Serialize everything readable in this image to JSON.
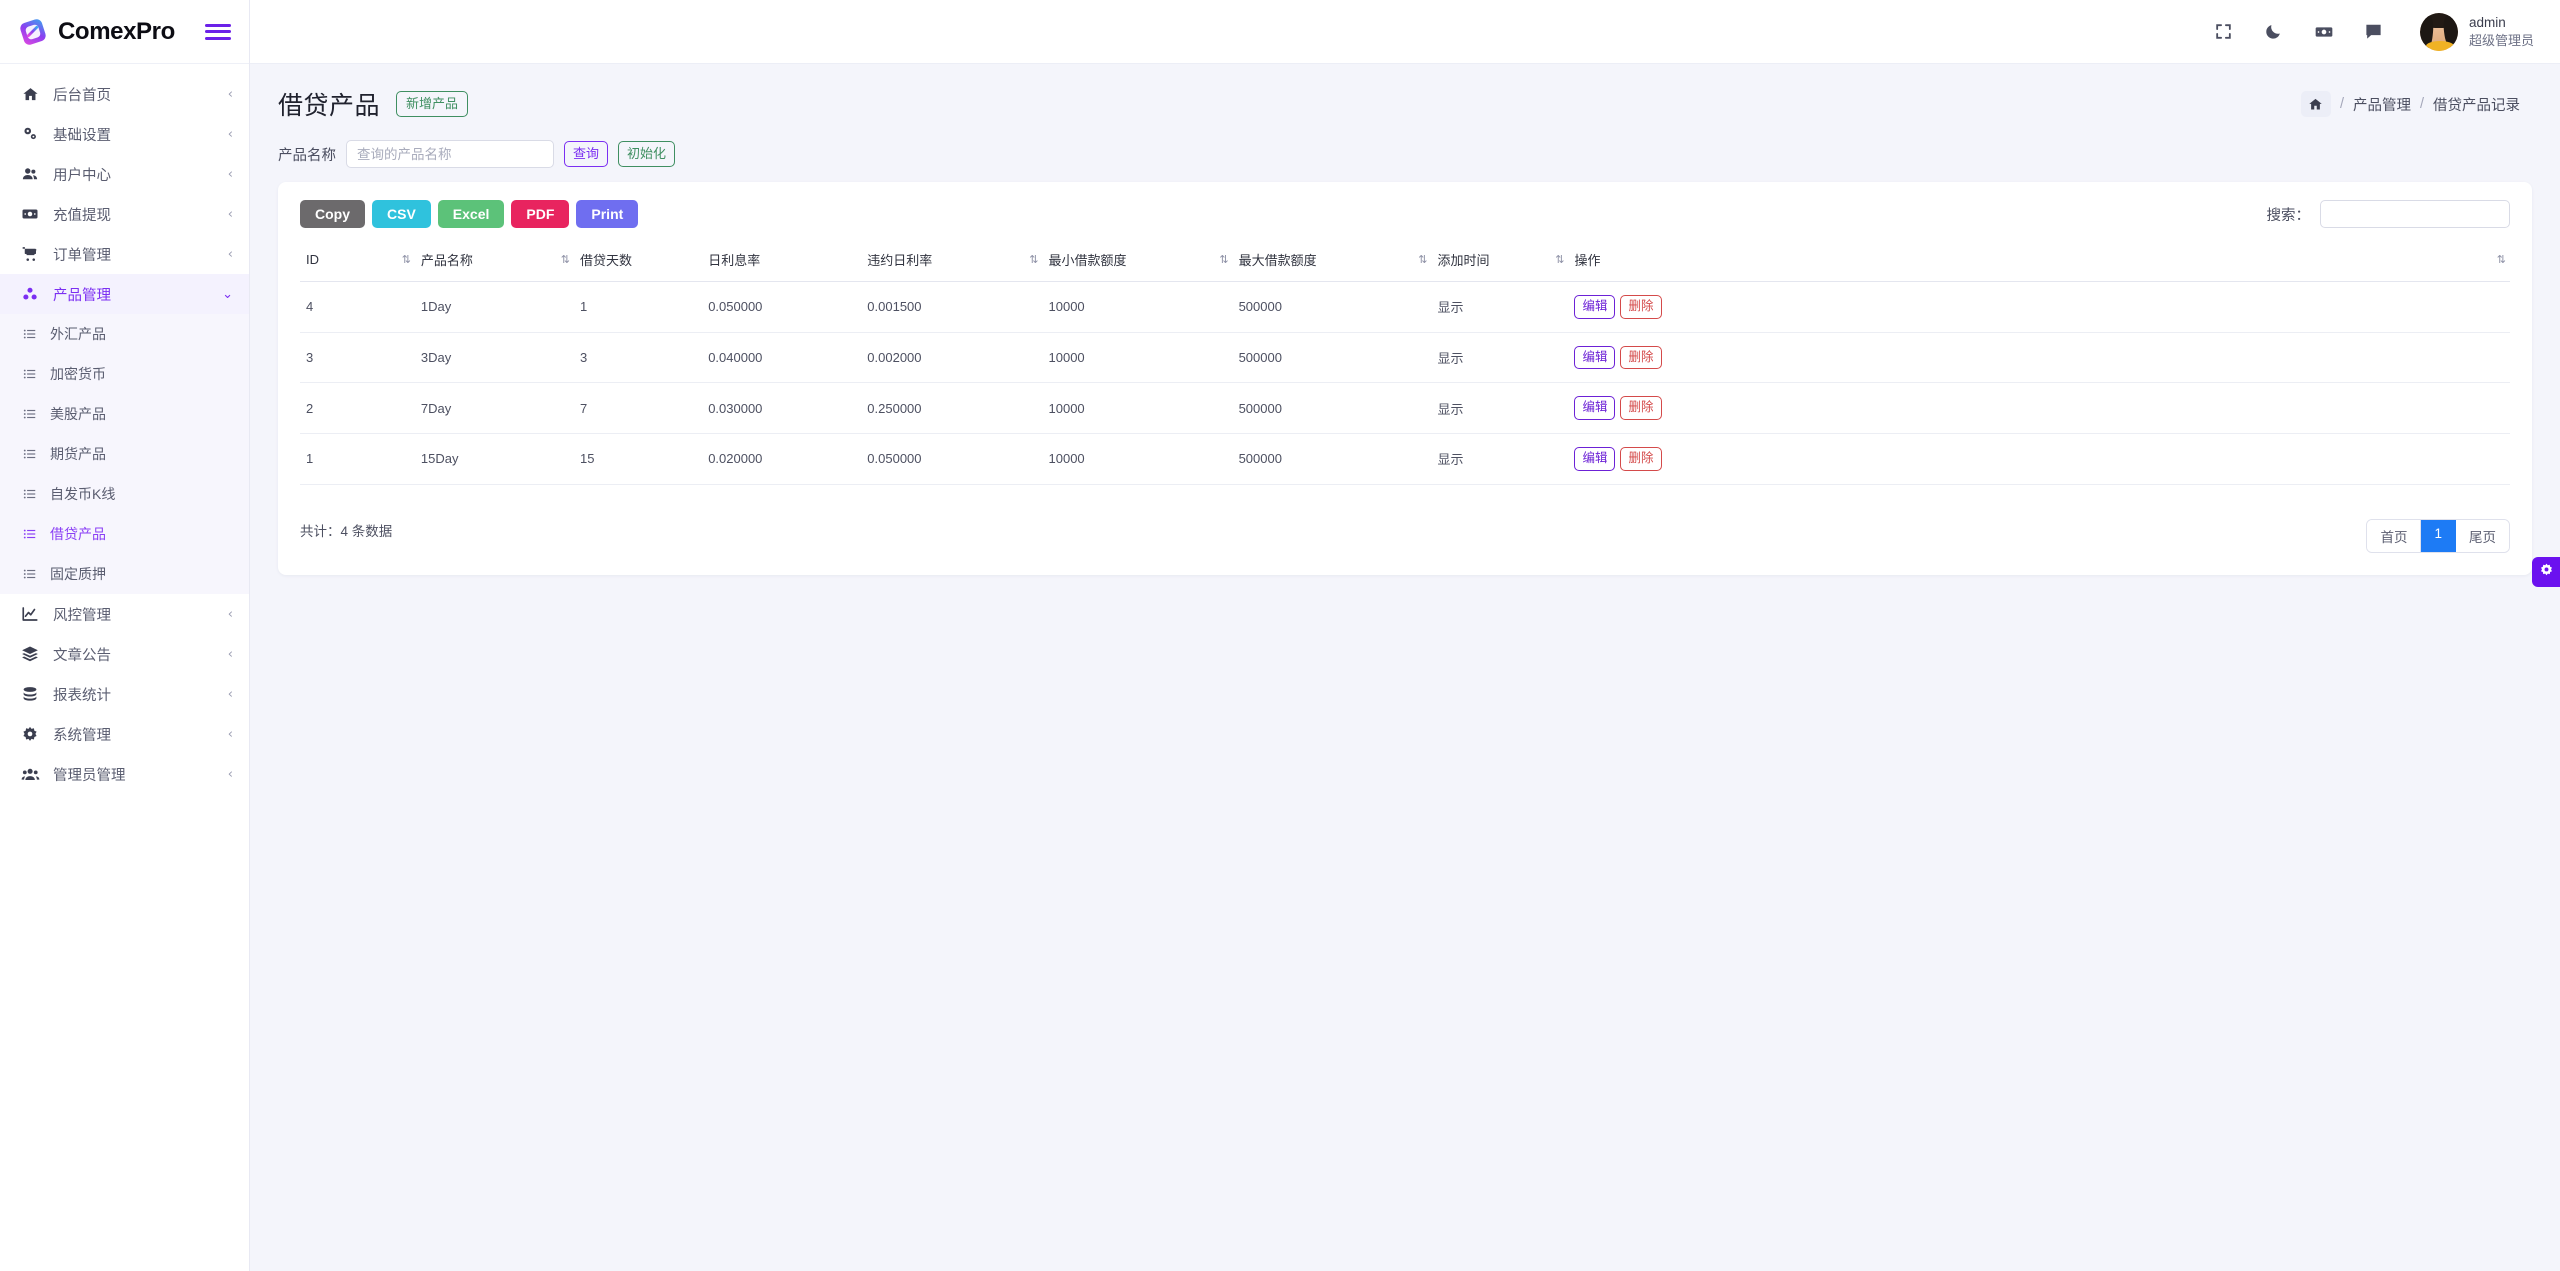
{
  "brand": {
    "name": "ComexPro",
    "logo_icon": "comexpro-logo-icon",
    "menu_toggle_icon": "hamburger-icon"
  },
  "topbar": {
    "icons": [
      {
        "name": "fullscreen-icon"
      },
      {
        "name": "dark-mode-moon-icon"
      },
      {
        "name": "money-icon"
      },
      {
        "name": "chat-icon"
      }
    ],
    "user": {
      "name": "admin",
      "role": "超级管理员",
      "avatar_name": "user-avatar"
    }
  },
  "sidebar": {
    "items": [
      {
        "label": "后台首页",
        "icon": "home-icon",
        "arrow": "‹",
        "active": false
      },
      {
        "label": "基础设置",
        "icon": "gears-icon",
        "arrow": "‹",
        "active": false
      },
      {
        "label": "用户中心",
        "icon": "users-icon",
        "arrow": "‹",
        "active": false
      },
      {
        "label": "充值提现",
        "icon": "money-icon",
        "arrow": "‹",
        "active": false
      },
      {
        "label": "订单管理",
        "icon": "cart-icon",
        "arrow": "‹",
        "active": false
      },
      {
        "label": "产品管理",
        "icon": "cubes-icon",
        "arrow": "⌄",
        "active": true
      },
      {
        "label": "风控管理",
        "icon": "chart-line-icon",
        "arrow": "‹",
        "active": false
      },
      {
        "label": "文章公告",
        "icon": "layers-icon",
        "arrow": "‹",
        "active": false
      },
      {
        "label": "报表统计",
        "icon": "coins-icon",
        "arrow": "‹",
        "active": false
      },
      {
        "label": "系统管理",
        "icon": "gear-icon",
        "arrow": "‹",
        "active": false
      },
      {
        "label": "管理员管理",
        "icon": "user-group-icon",
        "arrow": "‹",
        "active": false
      }
    ],
    "submenu": [
      {
        "label": "外汇产品",
        "icon": "list-icon",
        "active": false
      },
      {
        "label": "加密货币",
        "icon": "list-icon",
        "active": false
      },
      {
        "label": "美股产品",
        "icon": "list-icon",
        "active": false
      },
      {
        "label": "期货产品",
        "icon": "list-icon",
        "active": false
      },
      {
        "label": "自发币K线",
        "icon": "list-icon",
        "active": false
      },
      {
        "label": "借贷产品",
        "icon": "list-icon",
        "active": true
      },
      {
        "label": "固定质押",
        "icon": "list-icon",
        "active": false
      }
    ]
  },
  "page": {
    "title": "借贷产品",
    "new_button": "新增产品",
    "breadcrumb": {
      "home_icon": "home-icon",
      "sep": "/",
      "items": [
        "产品管理",
        "借贷产品记录"
      ]
    }
  },
  "filter": {
    "label": "产品名称",
    "placeholder": "查询的产品名称",
    "value": "",
    "query_button": "查询",
    "reset_button": "初始化"
  },
  "toolbar": {
    "export_buttons": [
      {
        "label": "Copy",
        "color": "#6c6a6c"
      },
      {
        "label": "CSV",
        "color": "#2fc2dd"
      },
      {
        "label": "Excel",
        "color": "#5cc279"
      },
      {
        "label": "PDF",
        "color": "#e8245f"
      },
      {
        "label": "Print",
        "color": "#6f6ef0"
      }
    ],
    "search_label": "搜索：",
    "search_placeholder": "",
    "search_value": ""
  },
  "table": {
    "columns": [
      {
        "label": "ID",
        "sortable": true
      },
      {
        "label": "产品名称",
        "sortable": true
      },
      {
        "label": "借贷天数",
        "sortable": false
      },
      {
        "label": "日利息率",
        "sortable": false
      },
      {
        "label": "违约日利率",
        "sortable": true
      },
      {
        "label": "最小借款额度",
        "sortable": true
      },
      {
        "label": "最大借款额度",
        "sortable": true
      },
      {
        "label": "添加时间",
        "sortable": true
      },
      {
        "label": "操作",
        "sortable": true
      }
    ],
    "rows": [
      {
        "id": "4",
        "name": "1Day",
        "days": "1",
        "daily_rate": "0.050000",
        "penalty_rate": "0.001500",
        "min_amount": "10000",
        "max_amount": "500000",
        "created": "显示",
        "edit": "编辑",
        "delete": "删除"
      },
      {
        "id": "3",
        "name": "3Day",
        "days": "3",
        "daily_rate": "0.040000",
        "penalty_rate": "0.002000",
        "min_amount": "10000",
        "max_amount": "500000",
        "created": "显示",
        "edit": "编辑",
        "delete": "删除"
      },
      {
        "id": "2",
        "name": "7Day",
        "days": "7",
        "daily_rate": "0.030000",
        "penalty_rate": "0.250000",
        "min_amount": "10000",
        "max_amount": "500000",
        "created": "显示",
        "edit": "编辑",
        "delete": "删除"
      },
      {
        "id": "1",
        "name": "15Day",
        "days": "15",
        "daily_rate": "0.020000",
        "penalty_rate": "0.050000",
        "min_amount": "10000",
        "max_amount": "500000",
        "created": "显示",
        "edit": "编辑",
        "delete": "删除"
      }
    ]
  },
  "footer": {
    "total_text": "共计：4 条数据",
    "pagination": [
      {
        "label": "首页",
        "active": false
      },
      {
        "label": "1",
        "active": true
      },
      {
        "label": "尾页",
        "active": false
      }
    ]
  },
  "fab": {
    "icon": "gear-icon"
  },
  "colors": {
    "accent_purple": "#7b2ff2",
    "green": "#3f8f61",
    "red": "#d44a4a",
    "page_bg": "#f4f5fb",
    "pager_active": "#1d7bf5"
  }
}
